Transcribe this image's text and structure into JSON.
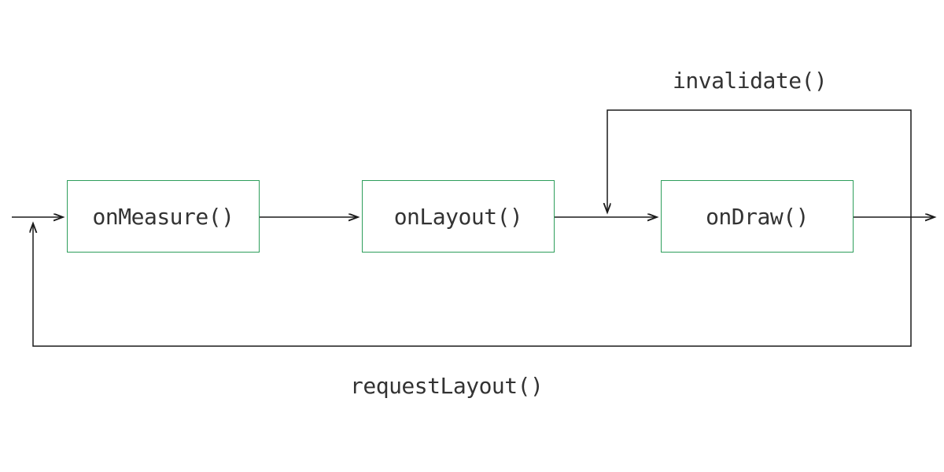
{
  "nodes": {
    "measure": "onMeasure()",
    "layout": "onLayout()",
    "draw": "onDraw()"
  },
  "labels": {
    "invalidate": "invalidate()",
    "requestLayout": "requestLayout()"
  },
  "colors": {
    "boxBorder": "#2e9e5b",
    "arrow": "#1a1a1a",
    "text": "#333333"
  }
}
